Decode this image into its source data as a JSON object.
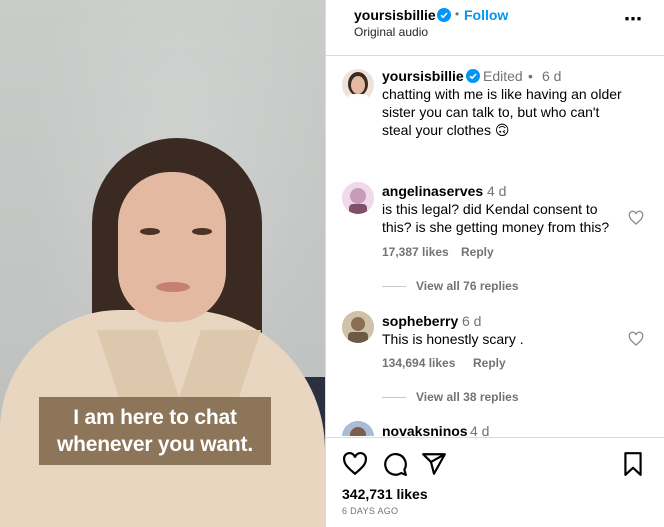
{
  "media": {
    "caption_line1": "I am here to chat",
    "caption_line2": "whenever you want."
  },
  "header": {
    "username": "yoursisbillie",
    "separator": "•",
    "follow_label": "Follow",
    "audio_label": "Original audio",
    "more_icon": "⋯"
  },
  "post_caption": {
    "username": "yoursisbillie",
    "edited": "Edited",
    "separator": "•",
    "time": "6 d",
    "text_line1": "chatting with me is like having an older",
    "text_line2": "sister you can talk to, but who can't",
    "text_line3": "steal your clothes 🙃"
  },
  "comments": [
    {
      "username": "angelinaserves",
      "time": "4 d",
      "text_line1": "is this legal? did Kendal consent to",
      "text_line2": "this? is she getting money from this?",
      "likes": "17,387 likes",
      "reply_label": "Reply",
      "view_replies": "View all 76 replies"
    },
    {
      "username": "sopheberry",
      "time": "6 d",
      "text_line1": "This is honestly scary .",
      "likes": "134,694 likes",
      "reply_label": "Reply",
      "view_replies": "View all 38 replies"
    },
    {
      "username": "novaksninos",
      "time": "4 d"
    }
  ],
  "footer": {
    "likes": "342,731 likes",
    "posted_ago": "6 DAYS AGO"
  },
  "colors": {
    "accent": "#0095f6",
    "caption_bg": "#8c7559",
    "muted": "#737373"
  },
  "icons": [
    "verified-badge-icon",
    "more-options-icon",
    "heart-icon",
    "comment-icon",
    "share-icon",
    "bookmark-icon"
  ]
}
